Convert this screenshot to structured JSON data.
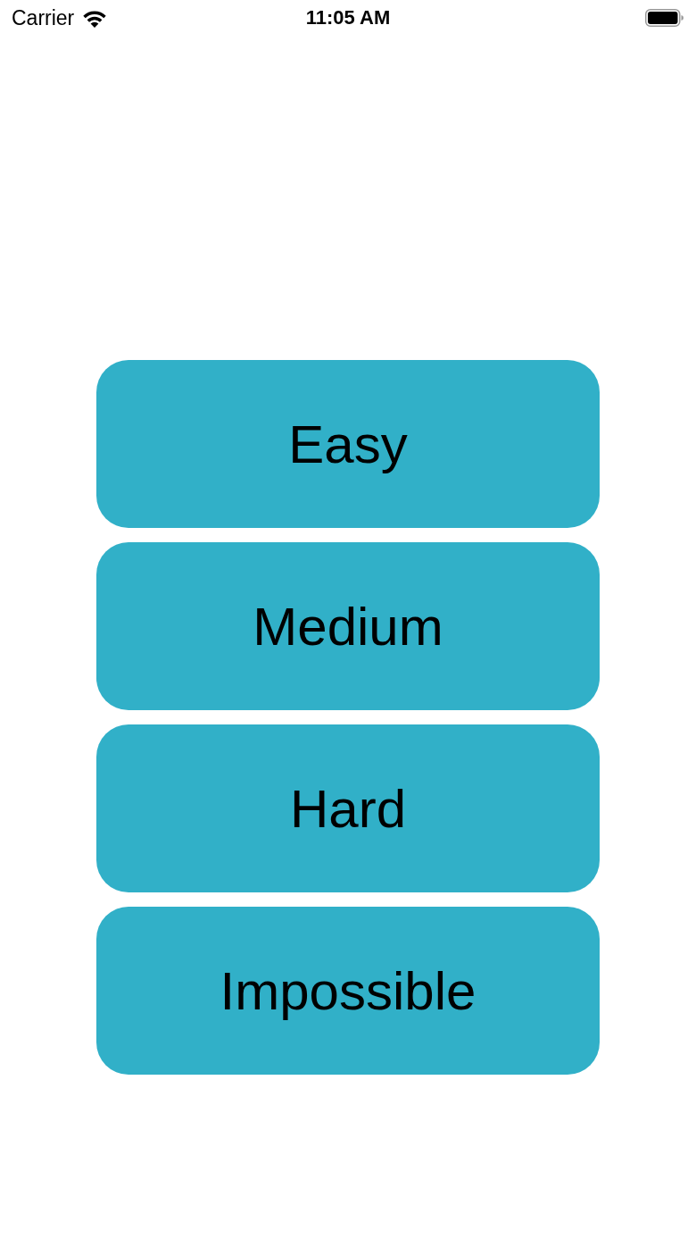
{
  "status_bar": {
    "carrier": "Carrier",
    "time": "11:05 AM"
  },
  "buttons": [
    {
      "label": "Easy"
    },
    {
      "label": "Medium"
    },
    {
      "label": "Hard"
    },
    {
      "label": "Impossible"
    }
  ]
}
